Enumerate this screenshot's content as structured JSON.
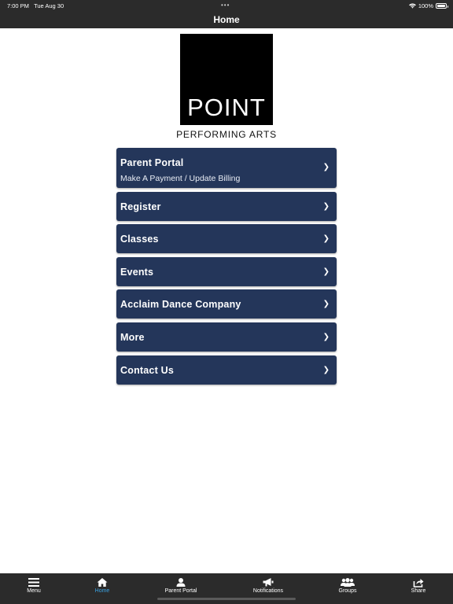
{
  "status_bar": {
    "time": "7:00 PM",
    "date": "Tue Aug 30",
    "dots": "•••",
    "battery": "100%"
  },
  "nav": {
    "title": "Home"
  },
  "logo": {
    "wordmark": "POINT",
    "subtitle": "PERFORMING ARTS"
  },
  "menu": {
    "items": [
      {
        "title": "Parent Portal",
        "subtitle": "Make A Payment / Update Billing"
      },
      {
        "title": "Register"
      },
      {
        "title": "Classes"
      },
      {
        "title": "Events"
      },
      {
        "title": "Acclaim Dance Company"
      },
      {
        "title": "More"
      },
      {
        "title": "Contact Us"
      }
    ],
    "chevron": "❯"
  },
  "tab_bar": {
    "active": "Home",
    "items": [
      {
        "label": "Menu",
        "icon": "hamburger-icon"
      },
      {
        "label": "Home",
        "icon": "home-icon"
      },
      {
        "label": "Parent Portal",
        "icon": "person-icon"
      },
      {
        "label": "Notifications",
        "icon": "megaphone-icon"
      },
      {
        "label": "Groups",
        "icon": "group-icon"
      },
      {
        "label": "Share",
        "icon": "share-icon"
      }
    ]
  },
  "colors": {
    "bar": "#2b2b2b",
    "button": "#24365a",
    "active_tab": "#3aa3e3"
  }
}
